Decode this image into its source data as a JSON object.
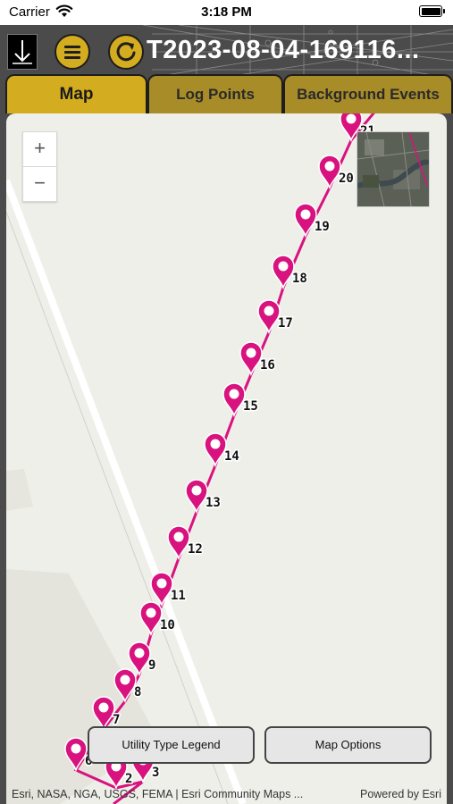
{
  "status_bar": {
    "carrier": "Carrier",
    "time": "3:18 PM"
  },
  "header": {
    "title": "T2023-08-04-169116...",
    "menu_icon": "hamburger-menu-icon",
    "refresh_icon": "refresh-icon",
    "logo_icon": "down-arrow-logo-icon",
    "accent_color": "#d4ac1f",
    "background_color": "#4a4b4a"
  },
  "tabs": [
    {
      "label": "Map",
      "selected": true
    },
    {
      "label": "Log Points",
      "selected": false
    },
    {
      "label": "Background Events",
      "selected": false
    }
  ],
  "map": {
    "zoom_in": "+",
    "zoom_out": "−",
    "route_color": "#d8127e",
    "markers": [
      {
        "label": "2"
      },
      {
        "label": "3"
      },
      {
        "label": "6"
      },
      {
        "label": "7"
      },
      {
        "label": "8"
      },
      {
        "label": "9"
      },
      {
        "label": "10"
      },
      {
        "label": "11"
      },
      {
        "label": "12"
      },
      {
        "label": "13"
      },
      {
        "label": "14"
      },
      {
        "label": "15"
      },
      {
        "label": "16"
      },
      {
        "label": "17"
      },
      {
        "label": "18"
      },
      {
        "label": "19"
      },
      {
        "label": "20"
      },
      {
        "label": "21"
      }
    ],
    "buttons": {
      "legend": "Utility Type Legend",
      "options": "Map Options"
    },
    "attribution": "Esri, NASA, NGA, USGS, FEMA | Esri Community Maps ...",
    "powered_by": "Powered by Esri"
  }
}
